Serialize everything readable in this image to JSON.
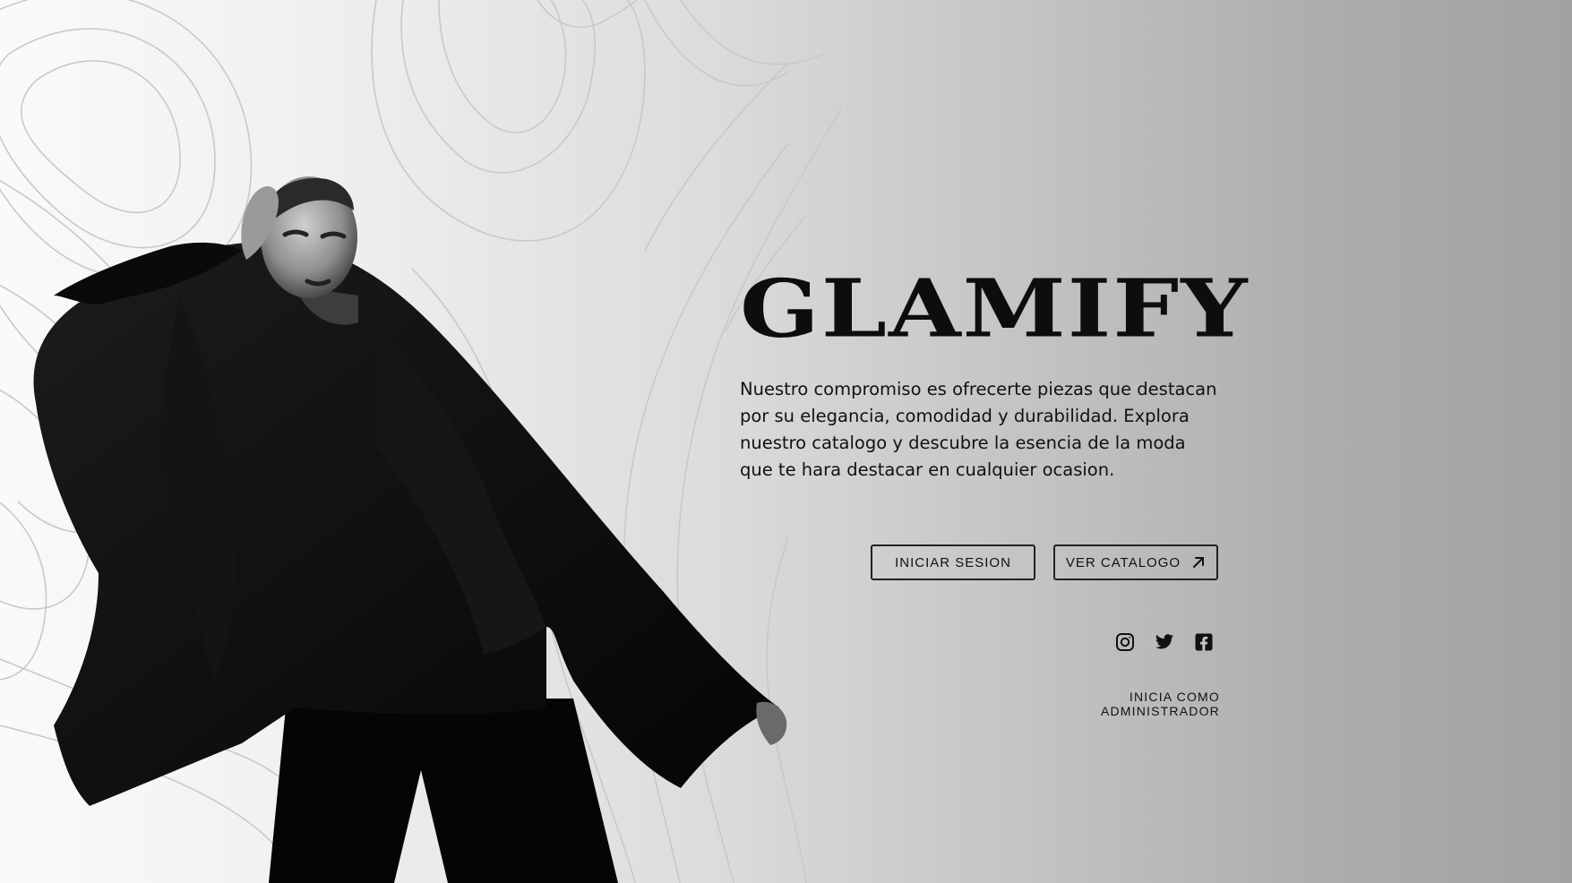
{
  "brand": {
    "name": "GLAMIFY"
  },
  "hero": {
    "tagline": "Nuestro compromiso es ofrecerte piezas que destacan por su elegancia, comodidad y durabilidad. Explora nuestro catalogo y descubre la esencia de la moda que te hara destacar en cualquier ocasion."
  },
  "actions": {
    "login_label": "INICIAR SESION",
    "catalog_label": "VER CATALOGO",
    "catalog_icon": "arrow-up-right-icon"
  },
  "social": [
    {
      "name": "instagram-icon"
    },
    {
      "name": "twitter-icon"
    },
    {
      "name": "facebook-icon"
    }
  ],
  "admin": {
    "label": "INICIA COMO ADMINISTRADOR"
  },
  "colors": {
    "text": "#111111",
    "background_light": "#fafafa",
    "background_dark": "#a2a2a2",
    "figure": "#050505"
  }
}
